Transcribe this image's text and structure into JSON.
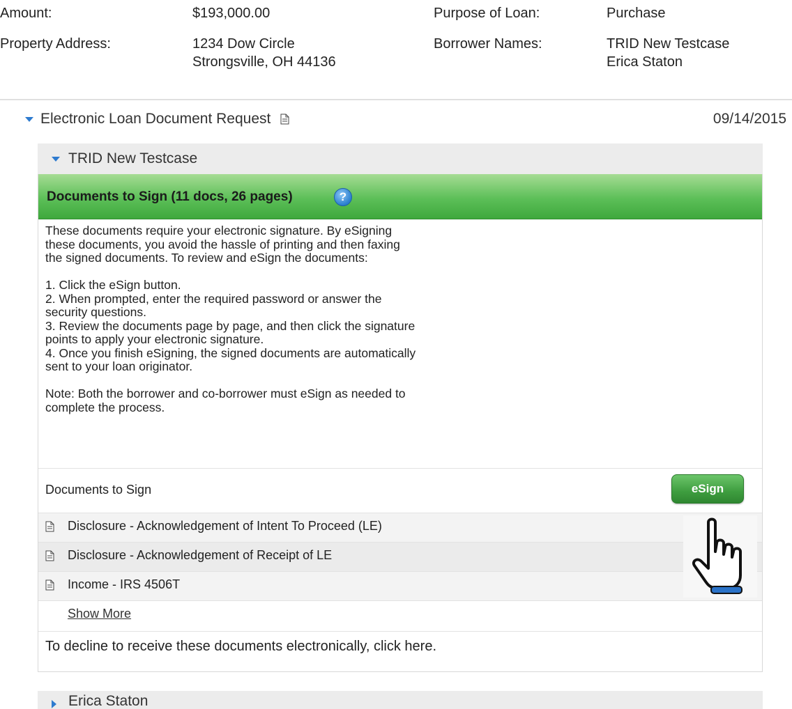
{
  "loan_summary": {
    "amount_label": "Amount:",
    "amount_value": "$193,000.00",
    "purpose_label": "Purpose of Loan:",
    "purpose_value": "Purchase",
    "address_label": "Property Address:",
    "address_line1": "1234 Dow Circle",
    "address_line2": "Strongsville, OH 44136",
    "borrowers_label": "Borrower Names:",
    "borrower1": "TRID New Testcase",
    "borrower2": "Erica Staton"
  },
  "request": {
    "title": "Electronic Loan Document Request",
    "date": "09/14/2015",
    "icon": "document-icon"
  },
  "borrower_panel": {
    "name": "TRID New Testcase",
    "header": "Documents to Sign (11 docs, 26 pages)",
    "help_icon": "?",
    "instructions": [
      "These documents require your electronic signature. By eSigning",
      "these documents, you avoid the hassle of printing and then faxing",
      "the signed documents. To review and eSign the documents:",
      "",
      "1. Click the eSign button.",
      "2. When prompted, enter the required password or answer the",
      "security questions.",
      "3. Review the documents page by page, and then click the signature",
      "points to apply your electronic signature.",
      "4. Once you finish eSigning, the signed documents are automatically",
      "sent to your loan originator.",
      "",
      "Note: Both the borrower and co-borrower must eSign as needed to",
      "complete the process."
    ],
    "documents_label": "Documents to Sign",
    "esign_label": "eSign",
    "documents": [
      "Disclosure - Acknowledgement of Intent To Proceed (LE)",
      "Disclosure - Acknowledgement of Receipt of LE",
      "Income - IRS 4506T"
    ],
    "show_more": "Show More",
    "decline_text": "To decline to receive these documents electronically, click here."
  },
  "second_borrower": {
    "name": "Erica Staton"
  },
  "colors": {
    "green_bar": "#5cbf58",
    "esign_button": "#3e9d3f",
    "caret": "#2e7bcf",
    "panel_header": "#ececec"
  }
}
